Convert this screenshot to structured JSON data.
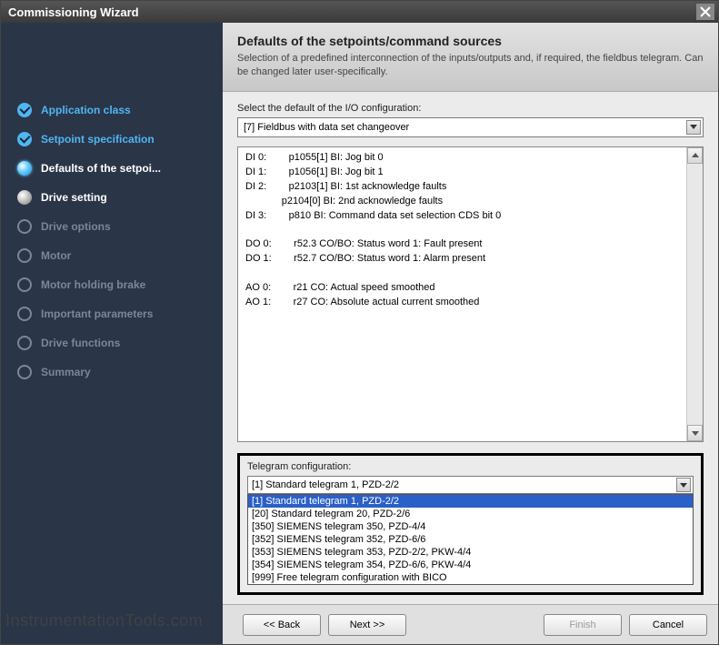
{
  "window": {
    "title": "Commissioning Wizard"
  },
  "sidebar": {
    "items": [
      {
        "label": "Application class",
        "state": "done"
      },
      {
        "label": "Setpoint specification",
        "state": "done"
      },
      {
        "label": "Defaults of the setpoi...",
        "state": "active"
      },
      {
        "label": "Drive setting",
        "state": "next"
      },
      {
        "label": "Drive options",
        "state": "future"
      },
      {
        "label": "Motor",
        "state": "future"
      },
      {
        "label": "Motor holding brake",
        "state": "future"
      },
      {
        "label": "Important parameters",
        "state": "future"
      },
      {
        "label": "Drive functions",
        "state": "future"
      },
      {
        "label": "Summary",
        "state": "future"
      }
    ]
  },
  "header": {
    "title": "Defaults of the setpoints/command sources",
    "desc": "Selection of a predefined interconnection of the inputs/outputs and, if required, the fieldbus telegram. Can be changed later user-specifically."
  },
  "io": {
    "label": "Select the default of the I/O configuration:",
    "selected": "[7] Fieldbus with data set changeover",
    "text": "DI 0:        p1055[1] BI: Jog bit 0\nDI 1:        p1056[1] BI: Jog bit 1\nDI 2:        p2103[1] BI: 1st acknowledge faults\n             p2104[0] BI: 2nd acknowledge faults\nDI 3:        p810 BI: Command data set selection CDS bit 0\n\nDO 0:        r52.3 CO/BO: Status word 1: Fault present\nDO 1:        r52.7 CO/BO: Status word 1: Alarm present\n\nAO 0:        r21 CO: Actual speed smoothed\nAO 1:        r27 CO: Absolute actual current smoothed"
  },
  "telegram": {
    "label": "Telegram configuration:",
    "selected": "[1] Standard telegram 1, PZD-2/2",
    "options": [
      "[1] Standard telegram 1, PZD-2/2",
      "[20] Standard telegram 20, PZD-2/6",
      "[350] SIEMENS telegram 350, PZD-4/4",
      "[352] SIEMENS telegram 352, PZD-6/6",
      "[353] SIEMENS telegram 353, PZD-2/2, PKW-4/4",
      "[354] SIEMENS telegram 354, PZD-6/6, PKW-4/4",
      "[999] Free telegram configuration with BICO"
    ]
  },
  "footer": {
    "back": "<< Back",
    "next": "Next >>",
    "finish": "Finish",
    "cancel": "Cancel"
  },
  "watermark": "InstrumentationTools.com"
}
